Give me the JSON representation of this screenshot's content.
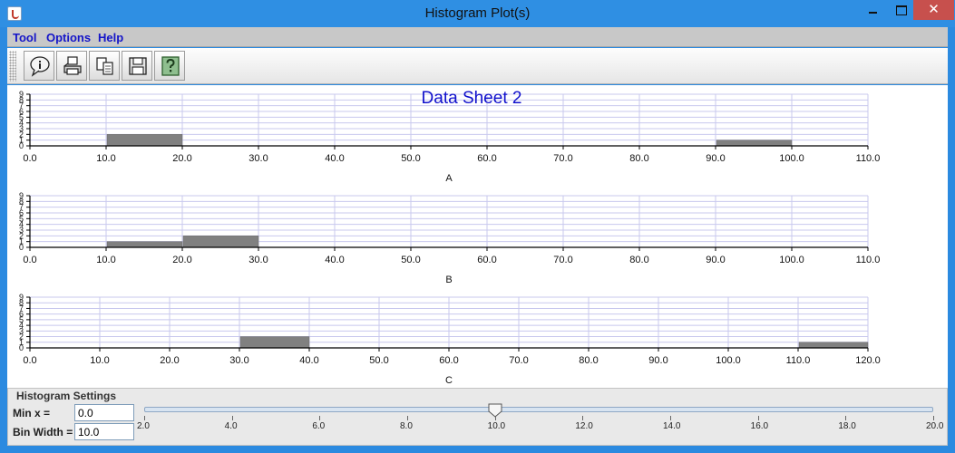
{
  "window": {
    "title": "Histogram Plot(s)",
    "close_glyph": "✕"
  },
  "menu": [
    {
      "label": "Tool"
    },
    {
      "label": "Options"
    },
    {
      "label": "Help"
    }
  ],
  "toolbar": [
    {
      "icon": "info-bubble-icon"
    },
    {
      "icon": "print-icon"
    },
    {
      "icon": "copy-icon"
    },
    {
      "icon": "save-disk-icon"
    },
    {
      "icon": "help-question-icon"
    }
  ],
  "colors": {
    "bar": "#808080",
    "grid": "#c8c8ee",
    "title": "#1010cc",
    "menu_text": "#1515c8",
    "close_button": "#c7504d"
  },
  "chart_data": [
    {
      "type": "bar",
      "title": "Data Sheet 2",
      "xlabel": "A",
      "xlim": [
        0,
        110
      ],
      "ylim": [
        0,
        9
      ],
      "x_ticks": [
        "0.0",
        "10.0",
        "20.0",
        "30.0",
        "40.0",
        "50.0",
        "60.0",
        "70.0",
        "80.0",
        "90.0",
        "100.0",
        "110.0"
      ],
      "y_ticks": [
        "0",
        "1",
        "2",
        "3",
        "4",
        "5",
        "6",
        "7",
        "8",
        "9"
      ],
      "bins": [
        {
          "start": 10,
          "end": 20,
          "count": 2
        },
        {
          "start": 90,
          "end": 100,
          "count": 1
        }
      ]
    },
    {
      "type": "bar",
      "title": "",
      "xlabel": "B",
      "xlim": [
        0,
        110
      ],
      "ylim": [
        0,
        9
      ],
      "x_ticks": [
        "0.0",
        "10.0",
        "20.0",
        "30.0",
        "40.0",
        "50.0",
        "60.0",
        "70.0",
        "80.0",
        "90.0",
        "100.0",
        "110.0"
      ],
      "y_ticks": [
        "0",
        "1",
        "2",
        "3",
        "4",
        "5",
        "6",
        "7",
        "8",
        "9"
      ],
      "bins": [
        {
          "start": 10,
          "end": 20,
          "count": 1
        },
        {
          "start": 20,
          "end": 30,
          "count": 2
        }
      ]
    },
    {
      "type": "bar",
      "title": "",
      "xlabel": "C",
      "xlim": [
        0,
        120
      ],
      "ylim": [
        0,
        9
      ],
      "x_ticks": [
        "0.0",
        "10.0",
        "20.0",
        "30.0",
        "40.0",
        "50.0",
        "60.0",
        "70.0",
        "80.0",
        "90.0",
        "100.0",
        "110.0",
        "120.0"
      ],
      "y_ticks": [
        "0",
        "1",
        "2",
        "3",
        "4",
        "5",
        "6",
        "7",
        "8",
        "9"
      ],
      "bins": [
        {
          "start": 30,
          "end": 40,
          "count": 2
        },
        {
          "start": 110,
          "end": 120,
          "count": 1
        }
      ]
    }
  ],
  "settings": {
    "legend": "Histogram Settings",
    "min_x_label": "Min x =",
    "min_x_value": "0.0",
    "bin_width_label": "Bin Width =",
    "bin_width_value": "10.0",
    "slider": {
      "min": 2.0,
      "max": 20.0,
      "value": 10.0,
      "labels": [
        "2.0",
        "4.0",
        "6.0",
        "8.0",
        "10.0",
        "12.0",
        "14.0",
        "16.0",
        "18.0",
        "20.0"
      ]
    }
  }
}
